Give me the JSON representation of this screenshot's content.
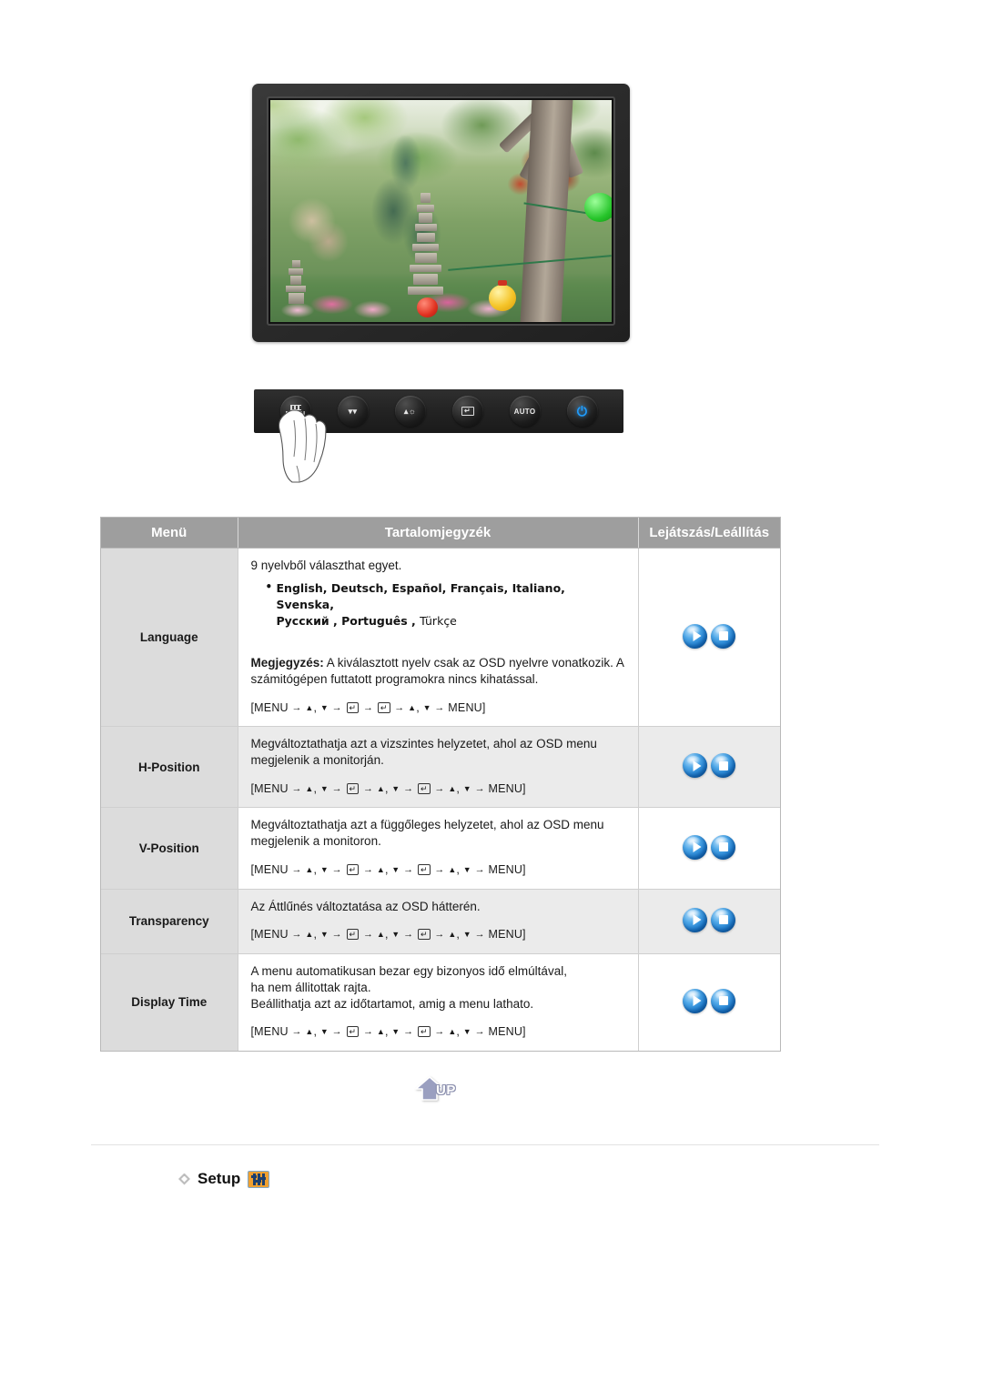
{
  "monitor": {
    "screen_image_alt": "korean-garden-with-stone-pagoda-and-lanterns",
    "buttons": [
      {
        "name": "menu-button",
        "label": "MENU",
        "glyph": "menu-bars"
      },
      {
        "name": "down-button",
        "label": "",
        "glyph": "down-arrow"
      },
      {
        "name": "brightness-button",
        "label": "",
        "glyph": "brightness"
      },
      {
        "name": "enter-button",
        "label": "",
        "glyph": "enter"
      },
      {
        "name": "auto-button",
        "label": "AUTO",
        "glyph": ""
      },
      {
        "name": "power-button",
        "label": "",
        "glyph": "power"
      }
    ],
    "power_led_color": "#1f9dff"
  },
  "table": {
    "headers": {
      "menu": "Menü",
      "contents": "Tartalomjegyzék",
      "playstop": "Lejátszás/Leállítás"
    },
    "rows": [
      {
        "menu": "Language",
        "intro": "9 nyelvből választhat egyet.",
        "languages_line1": "English, Deutsch, Español, Français,  Italiano, Svenska,",
        "languages_line2": "Русский , Português , ",
        "languages_line2_thin": "Türkçe",
        "note_label": "Megjegyzés:",
        "note_text": " A kiválasztott nyelv csak az OSD nyelvre vonatkozik. A számitógépen futtatott programokra nincs kihatással.",
        "sequence": "[MENU → ▲, ▼ → ↵ → ↵ → ▲, ▼ → MENU]",
        "seq_steps": [
          "MENU",
          "▲, ▼",
          "ENTER",
          "ENTER",
          "▲, ▼",
          "MENU"
        ]
      },
      {
        "menu": "H-Position",
        "text": "Megváltoztathatja azt a vizszintes helyzetet, ahol az OSD menu megjelenik a monitorján.",
        "sequence": "[MENU → ▲, ▼ → ↵ → ▲, ▼ → ↵ → ▲, ▼ → MENU]",
        "seq_steps": [
          "MENU",
          "▲, ▼",
          "ENTER",
          "▲, ▼",
          "ENTER",
          "▲, ▼",
          "MENU"
        ]
      },
      {
        "menu": "V-Position",
        "text": "Megváltoztathatja azt a függőleges helyzetet, ahol az OSD menu megjelenik a monitoron.",
        "sequence": "[MENU → ▲, ▼ → ↵ → ▲, ▼ → ↵ → ▲, ▼ → MENU]",
        "seq_steps": [
          "MENU",
          "▲, ▼",
          "ENTER",
          "▲, ▼",
          "ENTER",
          "▲, ▼",
          "MENU"
        ]
      },
      {
        "menu": "Transparency",
        "text": "Az Áttlűnés változtatása az OSD hátterén.",
        "sequence": "[MENU → ▲, ▼ → ↵ → ▲, ▼ → ↵ → ▲, ▼ → MENU]",
        "seq_steps": [
          "MENU",
          "▲, ▼",
          "ENTER",
          "▲, ▼",
          "ENTER",
          "▲, ▼",
          "MENU"
        ]
      },
      {
        "menu": "Display Time",
        "text_line1": "A menu automatikusan bezar egy bizonyos idő elmúltával,",
        "text_line2": "ha nem állitottak rajta.",
        "text_line3": "Beállithatja azt az időtartamot, amig a menu lathato.",
        "sequence": "[MENU → ▲, ▼ → ↵ → ▲, ▼ → ↵ → ▲, ▼ → MENU]",
        "seq_steps": [
          "MENU",
          "▲, ▼",
          "ENTER",
          "▲, ▼",
          "ENTER",
          "▲, ▼",
          "MENU"
        ]
      }
    ],
    "play_icon": "play-orb",
    "stop_icon": "stop-orb"
  },
  "up_button": {
    "label": "UP"
  },
  "setup": {
    "label": "Setup",
    "icon": "sliders-icon"
  },
  "colors": {
    "header_bg": "#9e9e9e",
    "menu_col_bg": "#dcdcdc",
    "row_alt_bg": "#ebebeb",
    "orb_blue": "#2f90dd",
    "setup_icon_orange": "#f0a030"
  }
}
